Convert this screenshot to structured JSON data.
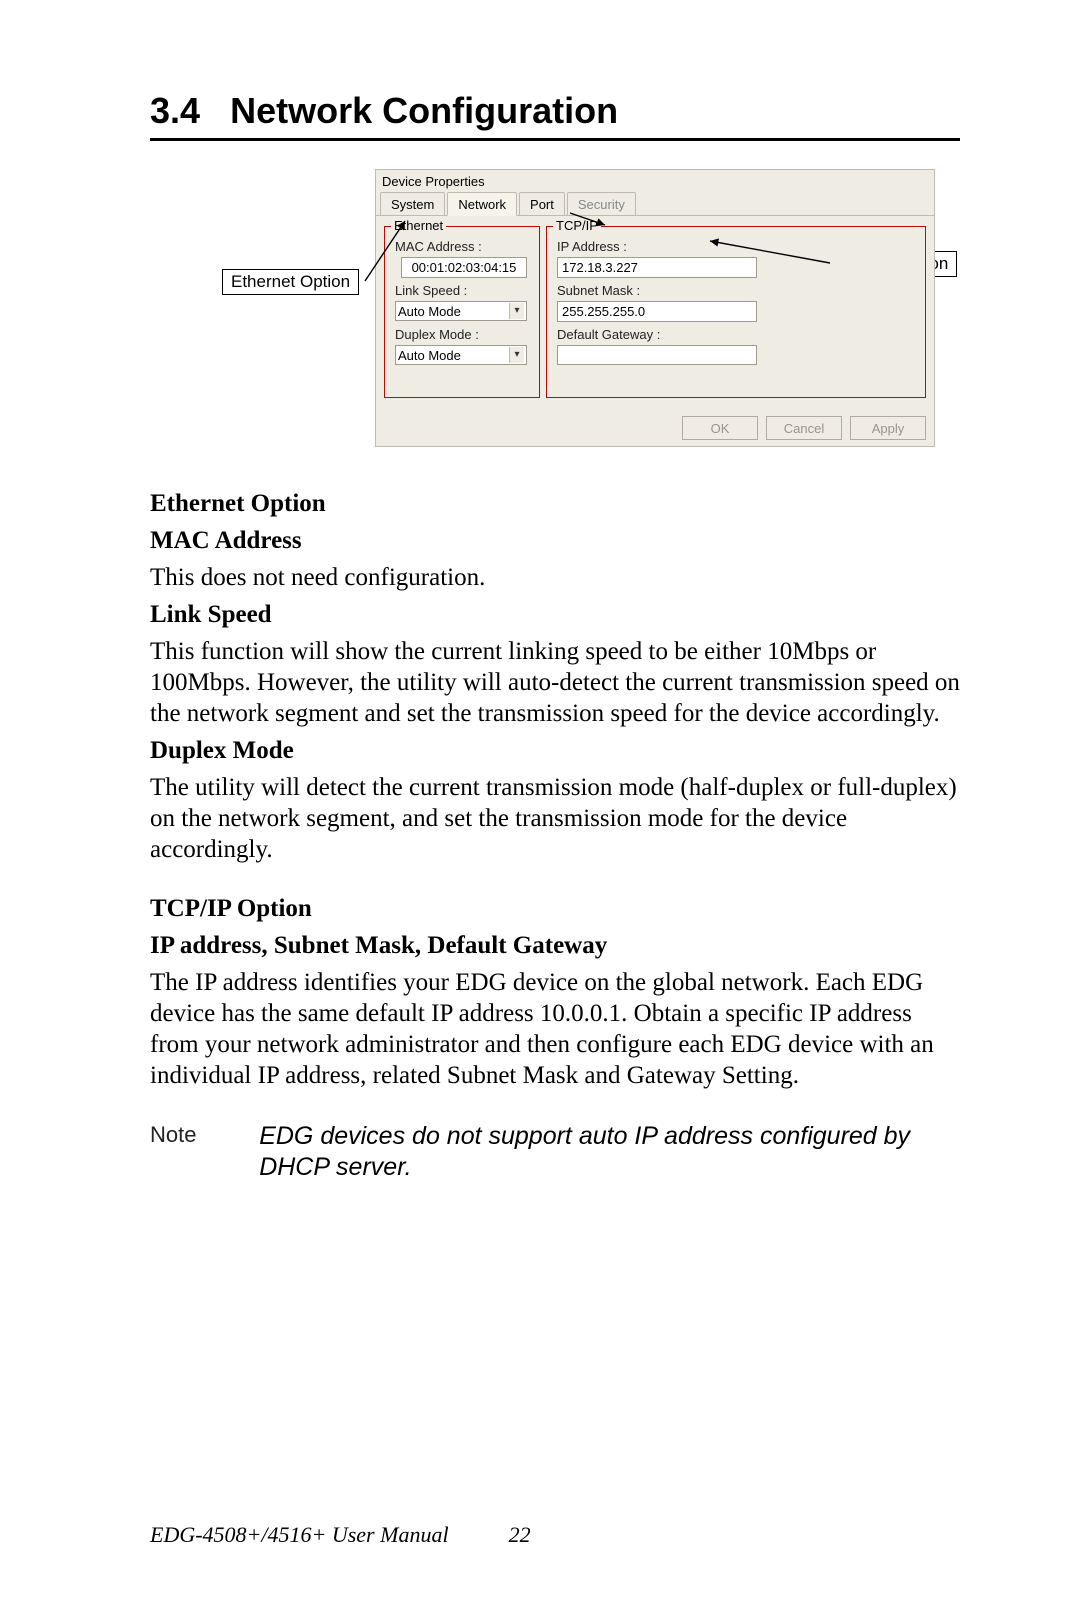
{
  "section": {
    "number": "3.4",
    "title": "Network Configuration"
  },
  "dialog": {
    "title": "Device Properties",
    "tabs": {
      "system": "System",
      "network": "Network",
      "port": "Port",
      "security": "Security"
    },
    "ethernet": {
      "group_title": "Ethernet",
      "mac_label": "MAC Address :",
      "mac_value": "00:01:02:03:04:15",
      "link_speed_label": "Link Speed :",
      "link_speed_value": "Auto Mode",
      "duplex_label": "Duplex Mode :",
      "duplex_value": "Auto Mode"
    },
    "tcpip": {
      "group_title": "TCP/IP",
      "ip_label": "IP Address :",
      "ip_value": "172.18.3.227",
      "subnet_label": "Subnet Mask :",
      "subnet_value": "255.255.255.0",
      "gateway_label": "Default Gateway :",
      "gateway_value": ""
    },
    "buttons": {
      "ok": "OK",
      "cancel": "Cancel",
      "apply": "Apply"
    }
  },
  "callouts": {
    "ethernet": "Ethernet Option",
    "tcpip": "TCP/IP Option"
  },
  "doc": {
    "h_eth_option": "Ethernet Option",
    "h_mac": "MAC Address",
    "p_mac": "This does not need configuration.",
    "h_link": "Link Speed",
    "p_link": "This function will show the current linking speed to be either 10Mbps or 100Mbps. However, the utility will auto-detect the current transmission speed on the network segment and set the transmission speed for the device accordingly.",
    "h_duplex": "Duplex Mode",
    "p_duplex": "The utility will detect the current transmission mode (half-duplex or full-duplex) on the network segment, and set the transmission mode for the device accordingly.",
    "h_tcp_option": "TCP/IP Option",
    "h_ip": "IP address, Subnet Mask, Default Gateway",
    "p_ip": "The IP address identifies your EDG device on the global network. Each EDG device has the same default IP address 10.0.0.1. Obtain a specific IP address from your network administrator and then configure each EDG device with an individual IP address, related Subnet Mask and Gateway Setting.",
    "note_label": "Note",
    "note_text": "EDG devices do not support auto IP address configured by DHCP server."
  },
  "footer": {
    "manual": "EDG-4508+/4516+ User Manual",
    "page": "22"
  }
}
